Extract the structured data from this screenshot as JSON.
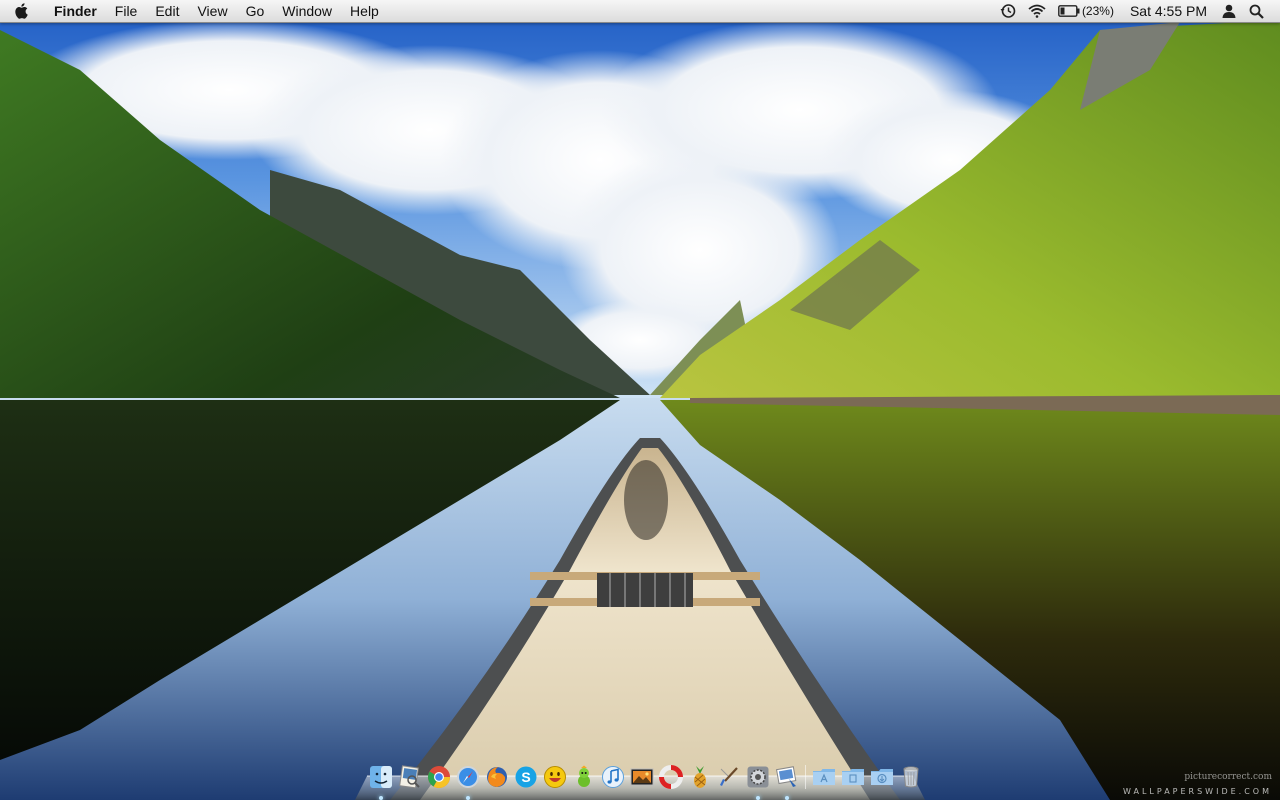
{
  "menubar": {
    "apple_icon": "apple-logo-icon",
    "app_name": "Finder",
    "menus": [
      "File",
      "Edit",
      "View",
      "Go",
      "Window",
      "Help"
    ],
    "status_icons": [
      "time-machine-icon",
      "wifi-icon",
      "battery-icon"
    ],
    "battery_percent": "(23%)",
    "clock": "Sat 4:55 PM",
    "user_icon": "user-icon",
    "spotlight_icon": "spotlight-search-icon"
  },
  "dock": {
    "apps": [
      {
        "icon": "finder-icon",
        "running": true
      },
      {
        "icon": "preview-icon",
        "running": false
      },
      {
        "icon": "chrome-icon",
        "running": false
      },
      {
        "icon": "safari-icon",
        "running": true
      },
      {
        "icon": "firefox-icon",
        "running": false
      },
      {
        "icon": "skype-icon",
        "running": false
      },
      {
        "icon": "messenger-smiley-icon",
        "running": false
      },
      {
        "icon": "adium-icon",
        "running": false
      },
      {
        "icon": "itunes-icon",
        "running": false
      },
      {
        "icon": "photo-browser-icon",
        "running": false
      },
      {
        "icon": "lifebuoy-icon",
        "running": false
      },
      {
        "icon": "pineapple-icon",
        "running": false
      },
      {
        "icon": "brush-icon",
        "running": false
      },
      {
        "icon": "system-preferences-icon",
        "running": true
      },
      {
        "icon": "iphoto-icon",
        "running": true
      }
    ],
    "stacks": [
      {
        "icon": "applications-folder-icon"
      },
      {
        "icon": "documents-folder-icon"
      },
      {
        "icon": "downloads-folder-icon"
      },
      {
        "icon": "trash-icon"
      }
    ]
  },
  "watermark": {
    "small": "picturecorrect.com",
    "main": "WALLPAPERSWIDE.COM"
  },
  "colors": {
    "menubar": "#e8e8e8",
    "sky": "#2f6fd0",
    "mountain_left": "#2e5e1a",
    "mountain_right": "#7ea32a",
    "canoe": "#e6dcc4",
    "running_indicator": "#bfe6ff"
  }
}
